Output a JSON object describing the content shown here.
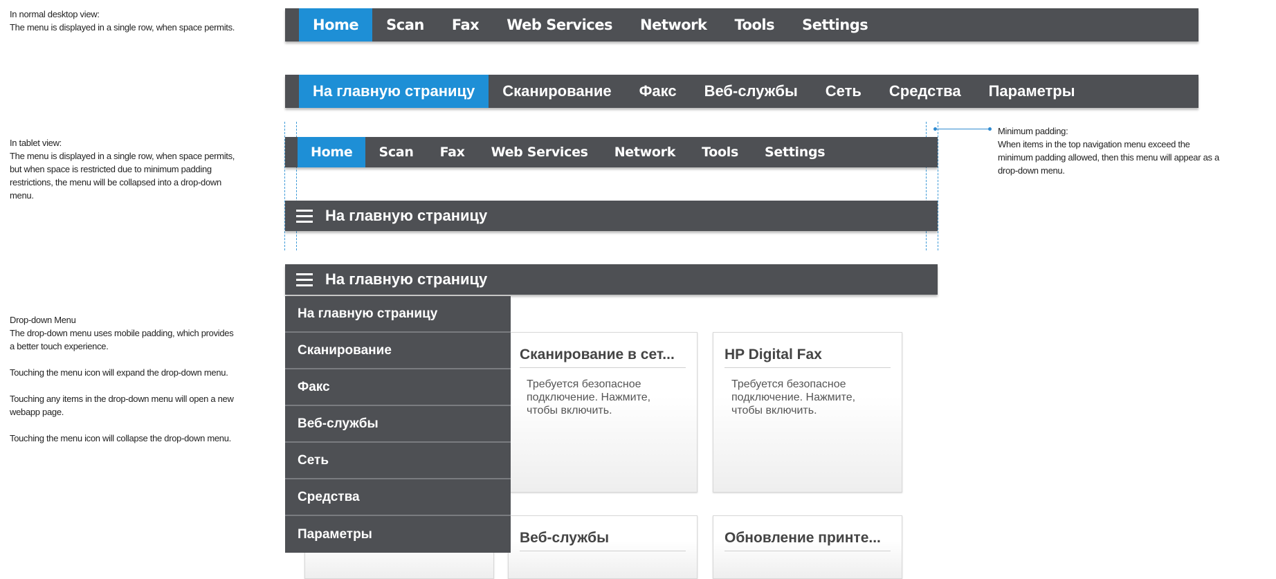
{
  "notes": {
    "desktop": [
      "In normal desktop view:",
      "The menu is displayed in a single row, when space permits."
    ],
    "tablet": [
      "In tablet view:",
      "The menu is displayed in a single row, when space permits,",
      "but when space is restricted due to minimum padding",
      "restrictions, the menu will be collapsed into a drop-down",
      "menu."
    ],
    "dropdown": [
      "Drop-down Menu",
      "The drop-down menu uses mobile padding, which provides",
      "a better touch experience."
    ],
    "dropdown_steps": [
      "Touching the menu icon will expand the drop-down menu.",
      "Touching any items in the drop-down menu will open a new",
      "webapp page.",
      "Touching the menu icon will collapse the drop-down menu."
    ],
    "padding": [
      "Minimum padding:",
      "When items in the top navigation menu exceed the",
      "minimum padding allowed, then this menu will appear as a",
      "drop-down menu."
    ]
  },
  "nav_en": [
    "Home",
    "Scan",
    "Fax",
    "Web Services",
    "Network",
    "Tools",
    "Settings"
  ],
  "nav_ru": [
    "На главную страницу",
    "Сканирование",
    "Факс",
    "Веб-службы",
    "Сеть",
    "Средства",
    "Параметры"
  ],
  "collapsed_title": "На главную страницу",
  "cards": [
    {
      "title": "Сканирование в сет...",
      "desc": "Требуется безопасное подключение. Нажмите, чтобы включить."
    },
    {
      "title": "HP Digital Fax",
      "desc": "Требуется безопасное подключение. Нажмите, чтобы включить."
    },
    {
      "title": "Веб-службы",
      "desc": ""
    },
    {
      "title": "Обновление принте...",
      "desc": ""
    }
  ],
  "colors": {
    "bar": "#4e5054",
    "active": "#1e8fd6",
    "guide": "#3d9ad8"
  },
  "icons": {
    "menu": "hamburger-menu-icon"
  }
}
